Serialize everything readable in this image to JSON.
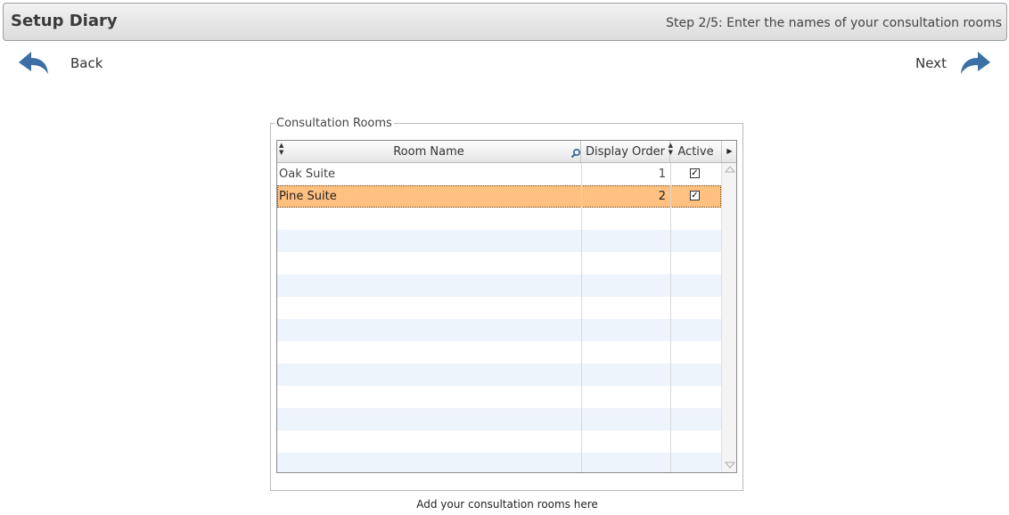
{
  "header": {
    "title": "Setup Diary",
    "step": "Step 2/5: Enter the names of your consultation rooms"
  },
  "nav": {
    "back_label": "Back",
    "next_label": "Next"
  },
  "rooms_group": {
    "legend": "Consultation Rooms",
    "columns": {
      "room_name": "Room Name",
      "display_order": "Display Order",
      "active": "Active"
    },
    "rows": [
      {
        "name": "Oak Suite",
        "order": "1",
        "active": true,
        "selected": false
      },
      {
        "name": "Pine Suite",
        "order": "2",
        "active": true,
        "selected": true
      }
    ]
  },
  "hint": "Add your consultation rooms here",
  "colors": {
    "selected_row": "#ffc080",
    "alt_row": "#edf4fb",
    "arrow_blue": "#3b6fa5"
  },
  "icons": {
    "back": "back-arrow-icon",
    "next": "next-arrow-icon",
    "column_search": "magnifier-icon",
    "column_chooser": "caret-right-icon"
  }
}
